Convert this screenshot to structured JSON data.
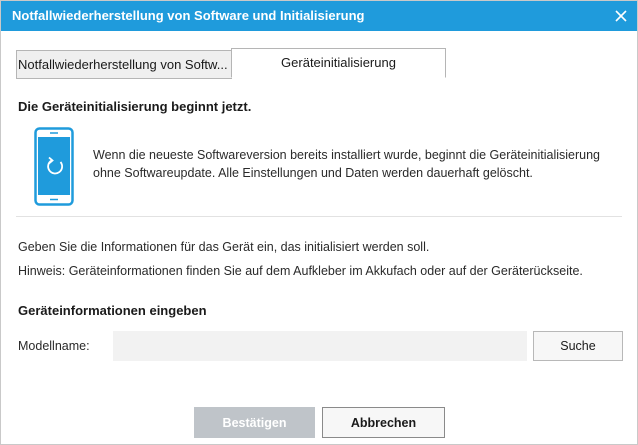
{
  "window": {
    "title": "Notfallwiederherstellung von Software und Initialisierung",
    "close_icon": "close-icon",
    "accent_color": "#1f9bdc"
  },
  "tabs": [
    {
      "label": "Notfallwiederherstellung von Softw...",
      "selected": false
    },
    {
      "label": "Geräteinitialisierung",
      "selected": true
    }
  ],
  "main": {
    "headline": "Die Geräteinitialisierung beginnt jetzt.",
    "phone_icon": "phone-refresh-icon",
    "description": "Wenn die neueste Softwareversion bereits installiert wurde, beginnt die Geräteinitialisierung ohne Softwareupdate. Alle Einstellungen und Daten werden dauerhaft gelöscht.",
    "instruction": "Geben Sie die Informationen für das Gerät ein, das initialisiert werden soll.",
    "hint": "Hinweis: Geräteinformationen finden Sie auf dem Aufkleber im Akkufach oder auf der Geräterückseite."
  },
  "device_info": {
    "section_title": "Geräteinformationen eingeben",
    "model_label": "Modellname:",
    "model_value": "",
    "search_label": "Suche"
  },
  "footer": {
    "confirm_label": "Bestätigen",
    "confirm_enabled": false,
    "cancel_label": "Abbrechen"
  }
}
